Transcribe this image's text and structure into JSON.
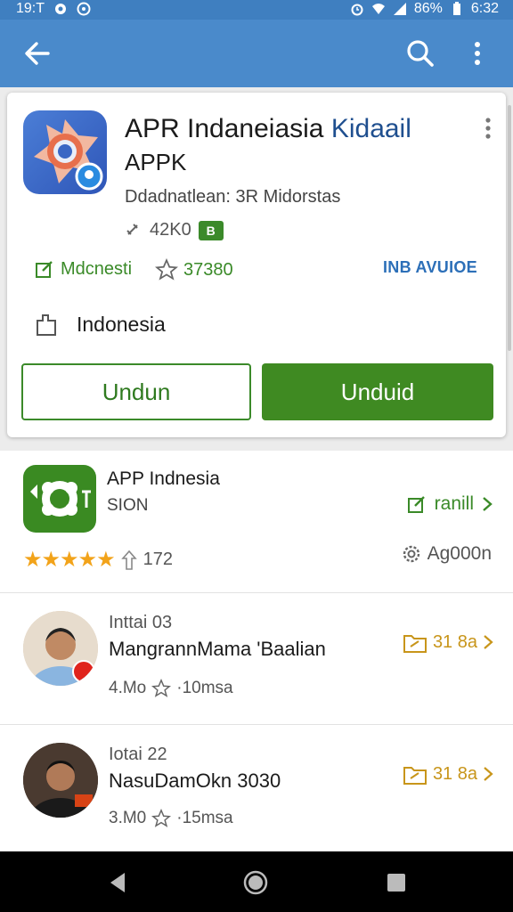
{
  "status_bar": {
    "time_left": "19:T",
    "battery": "86%",
    "clock": "6:32"
  },
  "app_bar": {
    "back_icon": "arrow-left-icon",
    "search_icon": "search-icon",
    "more_icon": "more-vert-icon"
  },
  "app_card": {
    "title": "APR Indaneiasia",
    "title_accent": "Kidaail",
    "subtitle": "APPK",
    "description": "Ddadnatlean: 3R Midorstas",
    "size": "42K0",
    "size_badge": "B",
    "category": "Mdcnesti",
    "rating_count": "37380",
    "right_tag": "INB AVUIOE",
    "country": "Indonesia",
    "button_outline": "Undun",
    "button_solid": "Unduid",
    "colors": {
      "green": "#3f8a22",
      "blue": "#4a8acb"
    }
  },
  "list": {
    "app_item": {
      "name": "APP Indnesia",
      "sub": "SION",
      "action": "ranill",
      "stars": "★★★★★",
      "rating": "172",
      "setting": "Ag000n"
    },
    "people": [
      {
        "title": "Inttai 03",
        "name": "MangrannMama 'Baalian",
        "meta_left": "4.Mo",
        "meta_right": "·10msa",
        "action": "31 8a"
      },
      {
        "title": "Iotai 22",
        "name": "NasuDamOkn 3030",
        "meta_left": "3.M0",
        "meta_right": "·15msa",
        "action": "31 8a"
      }
    ]
  }
}
